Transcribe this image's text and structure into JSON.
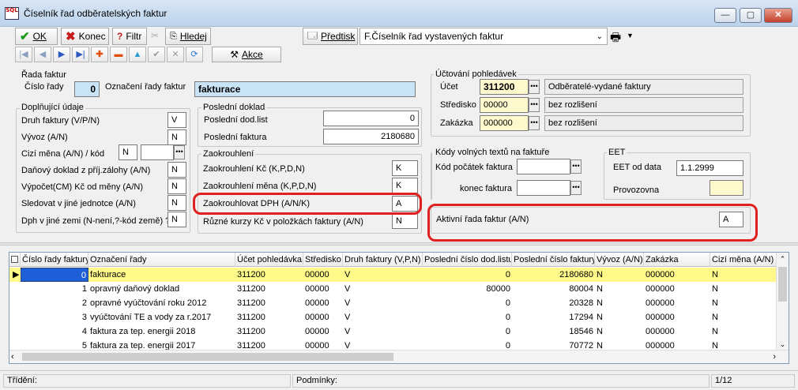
{
  "window": {
    "title": "Číselník řad odběratelských faktur",
    "logo": "SQL",
    "min": "—",
    "max": "▢",
    "close": "✕"
  },
  "toolbar": {
    "ok": "OK",
    "konec": "Konec",
    "filtr": "Filtr",
    "hledej": "Hledej",
    "predtisk": "Předtisk",
    "report": "F.Číselník řad vystavených faktur",
    "akce": "Akce"
  },
  "rada": {
    "group": "Řada faktur",
    "cislo_label": "Číslo řady",
    "cislo": "0",
    "oznaceni_label": "Označení řady faktur",
    "oznaceni": "fakturace"
  },
  "doplnujici": {
    "group": "Doplňující údaje",
    "druh_label": "Druh faktury (V/P/N)",
    "druh": "V",
    "vyvoz_label": "Vývoz (A/N)",
    "vyvoz": "N",
    "cizi_label": "Cizí měna (A/N) / kód",
    "cizi": "N",
    "danovy_label": "Daňový doklad z příj.zálohy (A/N)",
    "danovy": "N",
    "vypocet_label": "Výpočet(CM) Kč od měny (A/N)",
    "vypocet": "N",
    "sledovat_label": "Sledovat v jiné jednotce (A/N)",
    "sledovat": "N",
    "dph_label": "Dph v jiné zemi (N-není,?-kód země) ?",
    "dph": "N"
  },
  "posledni": {
    "group": "Poslední doklad",
    "dodlist_label": "Poslední dod.list",
    "dodlist": "0",
    "faktura_label": "Poslední faktura",
    "faktura": "2180680"
  },
  "zaokrouhleni": {
    "group": "Zaokrouhlení",
    "kc_label": "Zaokrouhlení Kč (K,P,D,N)",
    "kc": "K",
    "mena_label": "Zaokrouhlení měna (K,P,D,N)",
    "mena": "K",
    "dph_label": "Zaokrouhlovat DPH (A/N/K)",
    "dph": "A",
    "kurzy_label": "Různé kurzy Kč v položkách faktury (A/N)",
    "kurzy": "N"
  },
  "uctovani": {
    "group": "Účtování pohledávek",
    "ucet_label": "Účet",
    "ucet": "311200",
    "ucet_name": "Odběratelé-vydané faktury",
    "stredisko_label": "Středisko",
    "stredisko": "00000",
    "stredisko_name": "bez rozlišení",
    "zakazka_label": "Zakázka",
    "zakazka": "000000",
    "zakazka_name": "bez rozlišení"
  },
  "kody": {
    "group": "Kódy volných textů na faktuře",
    "pocatek_label": "Kód počátek faktura",
    "konec_label": "konec faktura"
  },
  "eet": {
    "group": "EET",
    "od_label": "EET od data",
    "od": "1.1.2999",
    "provozovna_label": "Provozovna"
  },
  "aktivni": {
    "label": "Aktivní řada faktur (A/N)",
    "value": "A"
  },
  "grid": {
    "columns": [
      "Číslo řady faktury",
      "Označení řady",
      "Účet pohledávka",
      "Středisko",
      "Druh faktury (V,P,N)",
      "Poslední číslo dod.listu",
      "Poslední číslo faktury",
      "Vývoz (A/N)",
      "Zakázka",
      "Cizí měna (A/N)"
    ],
    "rows": [
      [
        "0",
        "fakturace",
        "311200",
        "00000",
        "V",
        "0",
        "2180680",
        "N",
        "000000",
        "N"
      ],
      [
        "1",
        "opravný daňový doklad",
        "311200",
        "00000",
        "V",
        "80000",
        "80004",
        "N",
        "000000",
        "N"
      ],
      [
        "2",
        "opravné vyúčtování roku 2012",
        "311200",
        "00000",
        "V",
        "0",
        "20328",
        "N",
        "000000",
        "N"
      ],
      [
        "3",
        "vyúčtování TE a vody za r.2017",
        "311200",
        "00000",
        "V",
        "0",
        "17294",
        "N",
        "000000",
        "N"
      ],
      [
        "4",
        "faktura za tep. energii 2018",
        "311200",
        "00000",
        "V",
        "0",
        "18546",
        "N",
        "000000",
        "N"
      ],
      [
        "5",
        "faktura za tep. energii 2017",
        "311200",
        "00000",
        "V",
        "0",
        "70772",
        "N",
        "000000",
        "N"
      ]
    ]
  },
  "status": {
    "trideni": "Třídění:",
    "podminky": "Podmínky:",
    "position": "1/12"
  },
  "colors": {
    "selected_row": "#fff98a",
    "highlight_ring": "#e02020",
    "title_field": "#c9e3f7"
  }
}
